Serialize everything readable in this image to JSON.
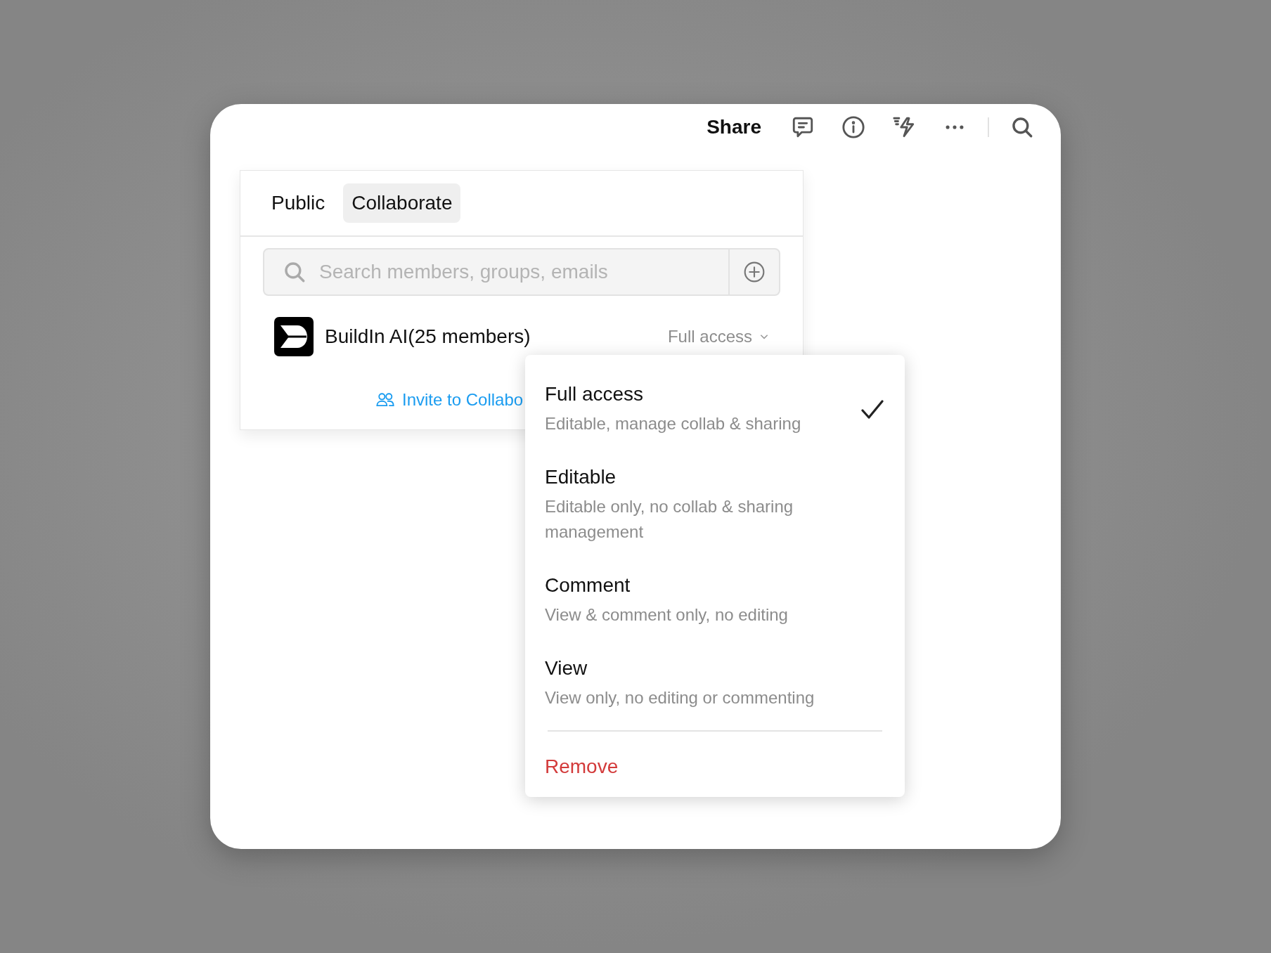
{
  "toolbar": {
    "share": "Share"
  },
  "share_panel": {
    "tabs": [
      {
        "label": "Public",
        "selected": false
      },
      {
        "label": "Collaborate",
        "selected": true
      }
    ],
    "search": {
      "placeholder": "Search members, groups, emails"
    },
    "members": [
      {
        "name": "BuildIn AI(25 members)",
        "access": "Full access"
      }
    ],
    "invite_link": "Invite to Collabo"
  },
  "access_menu": {
    "options": [
      {
        "title": "Full access",
        "description": "Editable, manage collab & sharing",
        "selected": true
      },
      {
        "title": "Editable",
        "description": "Editable only, no collab & sharing management",
        "selected": false
      },
      {
        "title": "Comment",
        "description": "View & comment only, no editing",
        "selected": false
      },
      {
        "title": "View",
        "description": "View only, no editing or commenting",
        "selected": false
      }
    ],
    "remove": "Remove"
  }
}
